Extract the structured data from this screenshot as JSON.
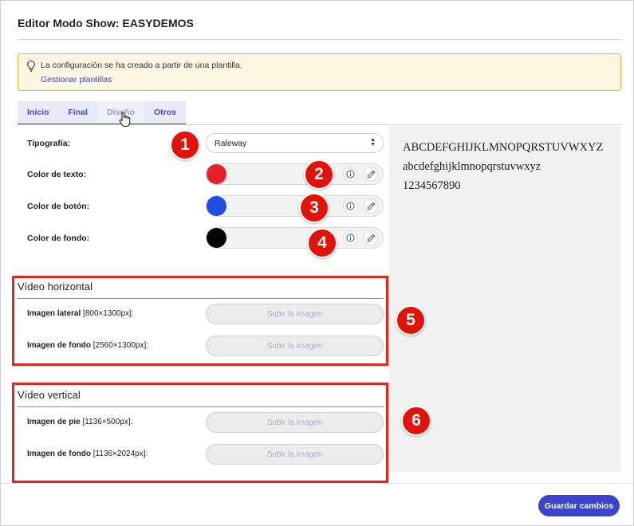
{
  "header": {
    "title": "Editor Modo Show: EASYDEMOS"
  },
  "notice": {
    "text": "La configuración se ha creado a partir de una plantilla.",
    "link": "Gestionar plantillas",
    "icon": "lightbulb-icon"
  },
  "tabs": [
    {
      "label": "Inicio",
      "active": false
    },
    {
      "label": "Final",
      "active": false
    },
    {
      "label": "Diseño",
      "active": true
    },
    {
      "label": "Otros",
      "active": false
    }
  ],
  "design": {
    "typography_label": "Tipografía:",
    "typography_value": "Raleway",
    "text_color_label": "Color de texto:",
    "text_color": "#e8202a",
    "button_color_label": "Color de botón:",
    "button_color": "#1f4fe0",
    "background_color_label": "Color de fondo:",
    "background_color": "#050505"
  },
  "preview": {
    "uppercase": "ABCDEFGHIJKLMNOPQRSTUVWXYZ",
    "lowercase": "abcdefghijklmnopqrstuvwxyz",
    "digits": "1234567890"
  },
  "horizontal": {
    "title": "Vídeo horizontal",
    "side_label": "Imagen lateral",
    "side_size": "[800×1300px]:",
    "bg_label": "Imagen de fondo",
    "bg_size": "[2560×1300px]:",
    "upload": "Subir la imagen"
  },
  "vertical": {
    "title": "Vídeo vertical",
    "foot_label": "Imagen de pie",
    "foot_size": "[1136×500px]:",
    "bg_label": "Imagen de fondo",
    "bg_size": "[1136×2024px]:",
    "upload": "Subir la imagen"
  },
  "badges": [
    "1",
    "2",
    "3",
    "4",
    "5",
    "6"
  ],
  "footer": {
    "save": "Guardar cambios"
  },
  "colors": {
    "accent": "#3a45c9",
    "annotation": "#e3120b",
    "notice_border": "#e5b33b"
  }
}
